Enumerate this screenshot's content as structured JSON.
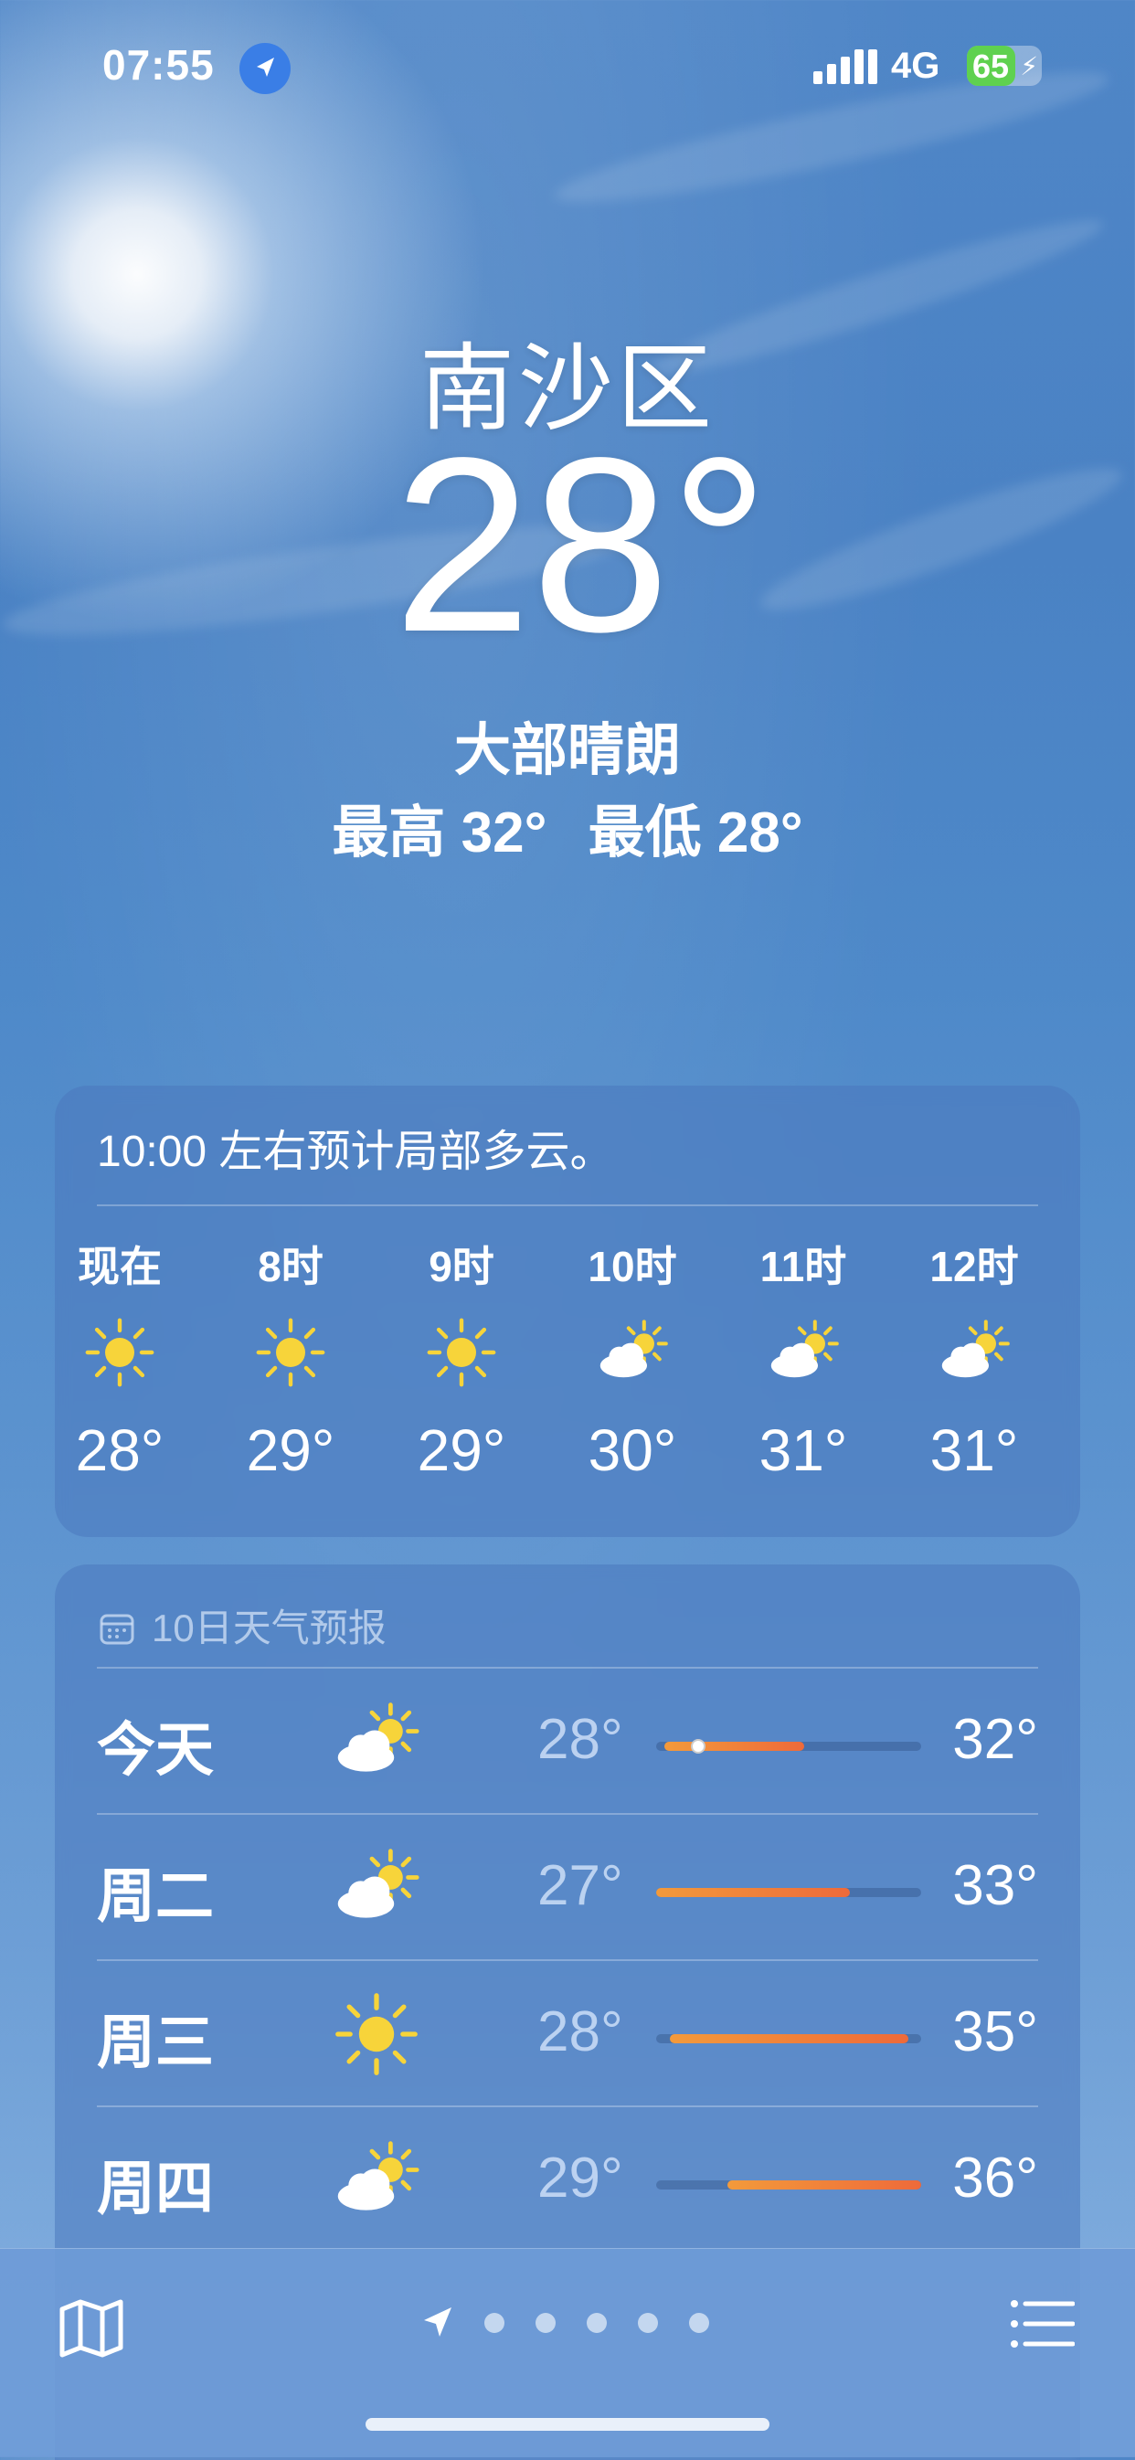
{
  "status_bar": {
    "time": "07:55",
    "network": "4G",
    "battery_level": "65",
    "battery_percent": 65,
    "location_icon": "location-arrow-icon",
    "signal_icon": "signal-bars-icon"
  },
  "header": {
    "city": "南沙区",
    "temperature": "28°",
    "condition": "大部晴朗",
    "high": "最高 32°",
    "low": "最低 28°"
  },
  "hourly": {
    "summary": "10:00 左右预计局部多云。",
    "hours": [
      {
        "label": "现在",
        "icon": "sun-icon",
        "temp": "28°"
      },
      {
        "label": "8时",
        "icon": "sun-icon",
        "temp": "29°"
      },
      {
        "label": "9时",
        "icon": "sun-icon",
        "temp": "29°"
      },
      {
        "label": "10时",
        "icon": "partly-cloudy-icon",
        "temp": "30°"
      },
      {
        "label": "11时",
        "icon": "partly-cloudy-icon",
        "temp": "31°"
      },
      {
        "label": "12时",
        "icon": "partly-cloudy-icon",
        "temp": "31°"
      }
    ]
  },
  "daily": {
    "title": "10日天气预报",
    "title_icon": "calendar-icon",
    "days": [
      {
        "name": "今天",
        "icon": "partly-cloudy-icon",
        "low": "28°",
        "high": "32°",
        "range_start": 0.03,
        "range_end": 0.56,
        "current": 0.16
      },
      {
        "name": "周二",
        "icon": "partly-cloudy-icon",
        "low": "27°",
        "high": "33°",
        "range_start": 0.0,
        "range_end": 0.73
      },
      {
        "name": "周三",
        "icon": "sun-icon",
        "low": "28°",
        "high": "35°",
        "range_start": 0.05,
        "range_end": 0.95
      },
      {
        "name": "周四",
        "icon": "partly-cloudy-icon",
        "low": "29°",
        "high": "36°",
        "range_start": 0.27,
        "range_end": 1.0
      }
    ]
  },
  "toolbar": {
    "map_icon": "map-icon",
    "list_icon": "list-icon",
    "location_page_icon": "location-arrow-icon",
    "page_count": 5
  },
  "colors": {
    "sky_top": "#4f86c7",
    "sky_bottom": "#86b1e0",
    "sun_yellow": "#f7d43a",
    "bar_orange": "#f39a3b",
    "bar_red": "#ee6a3a",
    "battery_green": "#5fd14f"
  }
}
